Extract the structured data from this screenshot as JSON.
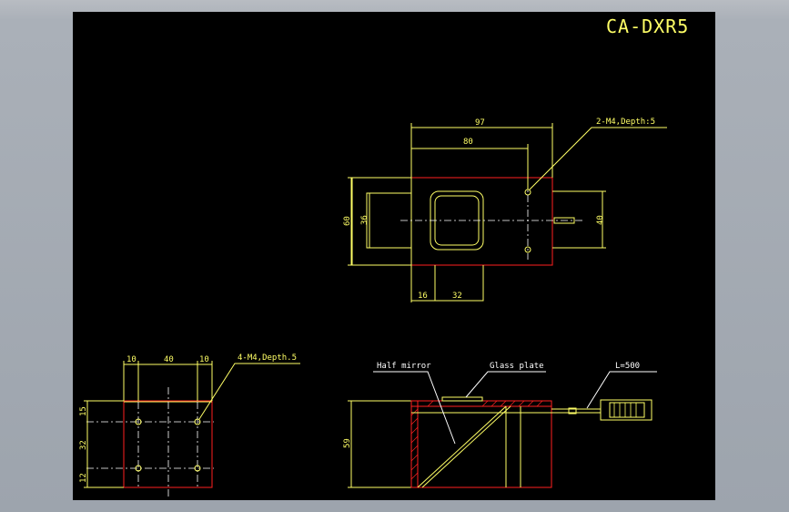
{
  "title": "CA-DXR5",
  "top_view": {
    "dim_97": "97",
    "dim_80": "80",
    "dim_60": "60",
    "dim_36": "36",
    "dim_40": "40",
    "dim_16": "16",
    "dim_32": "32",
    "callout": "2-M4,Depth:5"
  },
  "front_view": {
    "dim_10a": "10",
    "dim_40": "40",
    "dim_10b": "10",
    "dim_15": "15",
    "dim_32": "32",
    "dim_12": "12",
    "callout": "4-M4,Depth.5"
  },
  "side_view": {
    "label_half_mirror": "Half mirror",
    "label_glass_plate": "Glass plate",
    "label_cable": "L=500",
    "dim_59": "59"
  },
  "colors": {
    "outline": "#ffff66",
    "body": "#ff2020",
    "center": "#ffffff",
    "background": "#000000"
  }
}
